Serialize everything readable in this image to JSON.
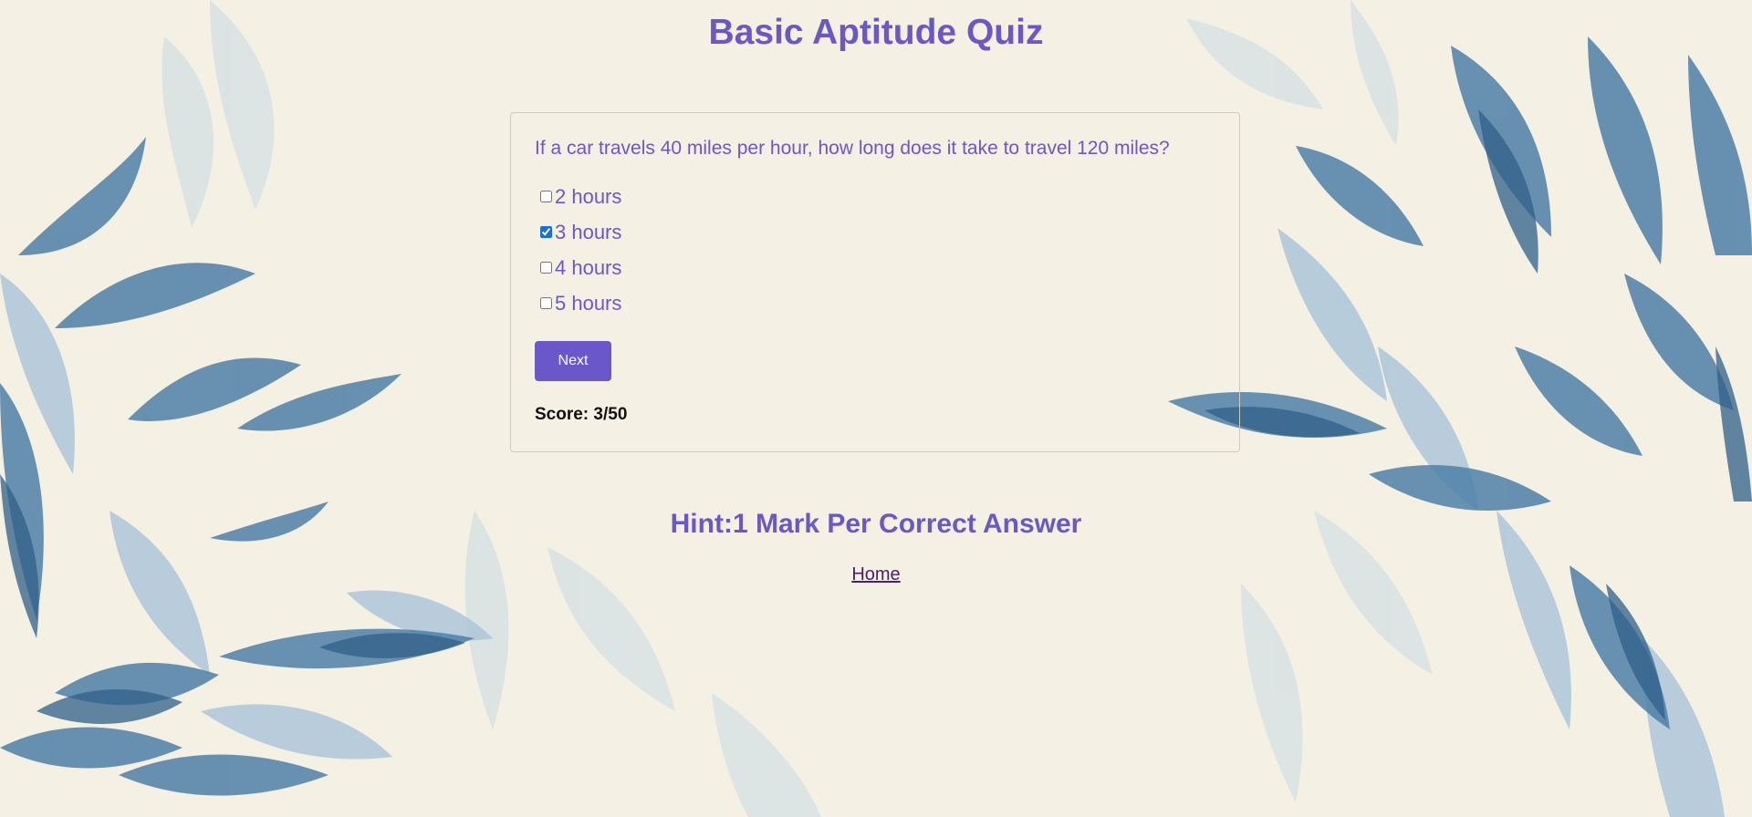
{
  "page": {
    "title": "Basic Aptitude Quiz",
    "hint": "Hint:1 Mark Per Correct Answer",
    "home_link": "Home"
  },
  "quiz": {
    "question": "If a car travels 40 miles per hour, how long does it take to travel 120 miles?",
    "options": [
      {
        "label": "2 hours",
        "checked": false
      },
      {
        "label": "3 hours",
        "checked": true
      },
      {
        "label": "4 hours",
        "checked": false
      },
      {
        "label": "5 hours",
        "checked": false
      }
    ],
    "next_label": "Next",
    "score": "Score: 3/50"
  },
  "colors": {
    "accent": "#6a57c9",
    "background": "#f4f1e4",
    "leaf_dark": "#3f6f98",
    "leaf_light": "#a9c3d8",
    "link": "#4b1e6e"
  }
}
